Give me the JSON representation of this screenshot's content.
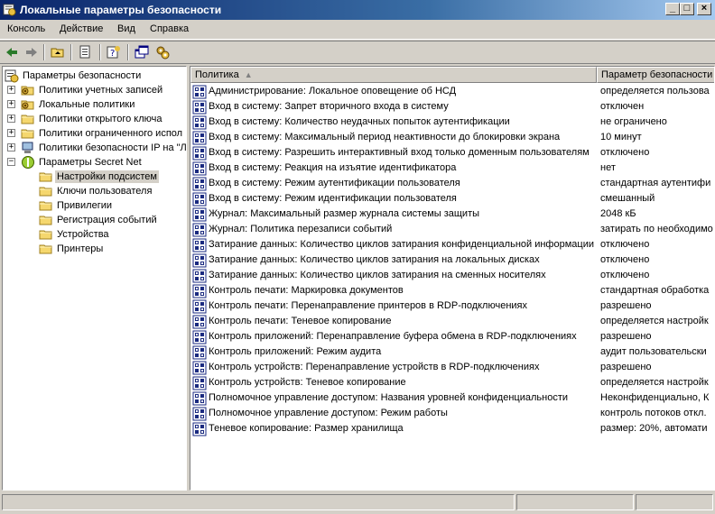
{
  "window": {
    "title": "Локальные параметры безопасности",
    "controls": {
      "minimize": "_",
      "maximize": "□",
      "close": "×"
    }
  },
  "menu": [
    "Консоль",
    "Действие",
    "Вид",
    "Справка"
  ],
  "tree": {
    "root": "Параметры безопасности",
    "items": [
      {
        "label": "Политики учетных записей",
        "expander": "+"
      },
      {
        "label": "Локальные политики",
        "expander": "+"
      },
      {
        "label": "Политики открытого ключа",
        "expander": "+"
      },
      {
        "label": "Политики ограниченного испол",
        "expander": "+"
      },
      {
        "label": "Политики безопасности IP на \"Л",
        "expander": "+"
      },
      {
        "label": "Параметры Secret Net",
        "expander": "−"
      }
    ],
    "secretnet_children": [
      "Настройки подсистем",
      "Ключи пользователя",
      "Привилегии",
      "Регистрация событий",
      "Устройства",
      "Принтеры"
    ]
  },
  "list": {
    "columns": {
      "policy": "Политика",
      "param": "Параметр безопасности"
    },
    "rows": [
      {
        "policy": "Администрирование: Локальное оповещение об НСД",
        "param": "определяется пользова"
      },
      {
        "policy": "Вход в систему: Запрет вторичного входа в систему",
        "param": "отключен"
      },
      {
        "policy": "Вход в систему: Количество неудачных попыток аутентификации",
        "param": "не ограничено"
      },
      {
        "policy": "Вход в систему: Максимальный период неактивности до блокировки экрана",
        "param": "10 минут"
      },
      {
        "policy": "Вход в систему: Разрешить интерактивный вход только доменным пользователям",
        "param": "отключено"
      },
      {
        "policy": "Вход в систему: Реакция на изъятие идентификатора",
        "param": "нет"
      },
      {
        "policy": "Вход в систему: Режим аутентификации пользователя",
        "param": "стандартная аутентифи"
      },
      {
        "policy": "Вход в систему: Режим идентификации пользователя",
        "param": "смешанный"
      },
      {
        "policy": "Журнал: Максимальный размер журнала системы защиты",
        "param": "2048 кБ"
      },
      {
        "policy": "Журнал: Политика перезаписи событий",
        "param": "затирать по необходимо"
      },
      {
        "policy": "Затирание данных: Количество циклов затирания конфиденциальной информации",
        "param": "отключено"
      },
      {
        "policy": "Затирание данных: Количество циклов затирания на локальных дисках",
        "param": "отключено"
      },
      {
        "policy": "Затирание данных: Количество циклов затирания на сменных носителях",
        "param": "отключено"
      },
      {
        "policy": "Контроль печати: Маркировка документов",
        "param": "стандартная обработка"
      },
      {
        "policy": "Контроль печати: Перенаправление принтеров в RDP-подключениях",
        "param": "разрешено"
      },
      {
        "policy": "Контроль печати: Теневое копирование",
        "param": "определяется настройк"
      },
      {
        "policy": "Контроль приложений: Перенаправление буфера обмена в RDP-подключениях",
        "param": "разрешено"
      },
      {
        "policy": "Контроль приложений: Режим аудита",
        "param": "аудит пользовательски"
      },
      {
        "policy": "Контроль устройств: Перенаправление устройств в RDP-подключениях",
        "param": "разрешено"
      },
      {
        "policy": "Контроль устройств: Теневое копирование",
        "param": "определяется настройк"
      },
      {
        "policy": "Полномочное управление доступом: Названия уровней конфиденциальности",
        "param": "Неконфиденциально, К"
      },
      {
        "policy": "Полномочное управление доступом: Режим работы",
        "param": "контроль потоков откл."
      },
      {
        "policy": "Теневое копирование: Размер хранилища",
        "param": "размер: 20%, автомати"
      }
    ]
  }
}
